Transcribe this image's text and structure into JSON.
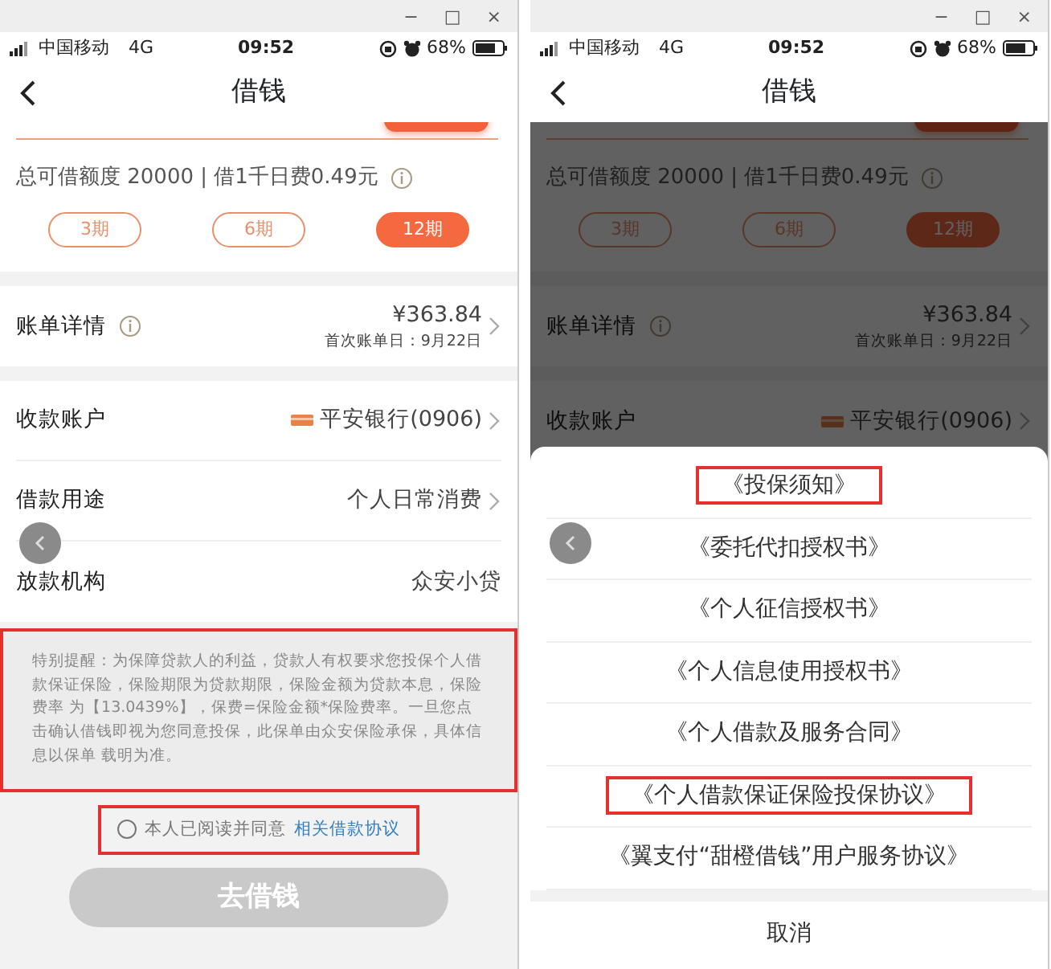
{
  "screens": [
    {
      "window_controls": [
        "−",
        "□",
        "×"
      ],
      "status_bar": {
        "carrier": "中国移动",
        "network": "4G",
        "time": "09:52",
        "battery": "68%"
      },
      "title": "借钱",
      "dimmed": false,
      "limit": "总可借额度 20000 | 借1千日费0.49元",
      "terms": [
        {
          "label": "3期",
          "selected": false
        },
        {
          "label": "6期",
          "selected": false
        },
        {
          "label": "12期",
          "selected": true
        }
      ],
      "sections": [
        {
          "rows": [
            {
              "kind": "bill",
              "label": "账单详情",
              "value": "¥363.84",
              "sub": "首次账单日：9月22日"
            }
          ]
        },
        {
          "rows": [
            {
              "kind": "account",
              "label": "收款账户",
              "value": "平安银行(0906)"
            },
            {
              "kind": "select",
              "label": "借款用途",
              "value": "个人日常消费"
            },
            {
              "kind": "plain",
              "label": "放款机构",
              "value": "众安小贷"
            }
          ]
        }
      ],
      "notice": {
        "text": "特别提醒：为保障贷款人的利益，贷款人有权要求您投保个人借款保证保险，保险期限为贷款期限，保险金额为贷款本息，保险费率 为【13.0439%】，保费=保险金额*保险费率。一旦您点击确认借钱即视为您同意投保，此保单由众安保险承保，具体信息以保单 载明为准。",
        "highlighted": true
      },
      "agreement": {
        "checked": false,
        "text": "本人已阅读并同意",
        "link": "相关借款协议",
        "highlighted": true
      },
      "submit": {
        "label": "去借钱",
        "disabled": true
      }
    },
    {
      "window_controls": [
        "−",
        "□",
        "×"
      ],
      "status_bar": {
        "carrier": "中国移动",
        "network": "4G",
        "time": "09:52",
        "battery": "68%"
      },
      "title": "借钱",
      "dimmed": true,
      "limit": "总可借额度 20000 | 借1千日费0.49元",
      "terms": [
        {
          "label": "3期",
          "selected": false
        },
        {
          "label": "6期",
          "selected": false
        },
        {
          "label": "12期",
          "selected": true
        }
      ],
      "sections": [
        {
          "rows": [
            {
              "kind": "bill",
              "label": "账单详情",
              "value": "¥363.84",
              "sub": "首次账单日：9月22日"
            }
          ]
        },
        {
          "rows": [
            {
              "kind": "account",
              "label": "收款账户",
              "value": "平安银行(0906)"
            }
          ]
        }
      ],
      "sheet": {
        "items": [
          {
            "label": "《投保须知》",
            "highlighted": true
          },
          {
            "label": "《委托代扣授权书》",
            "highlighted": false
          },
          {
            "label": "《个人征信授权书》",
            "highlighted": false
          },
          {
            "label": "《个人信息使用授权书》",
            "highlighted": false
          },
          {
            "label": "《个人借款及服务合同》",
            "highlighted": false
          },
          {
            "label": "《个人借款保证保险投保协议》",
            "highlighted": true
          },
          {
            "label": "《翼支付“甜橙借钱”用户服务协议》",
            "highlighted": false
          }
        ],
        "cancel": "取消"
      }
    }
  ]
}
